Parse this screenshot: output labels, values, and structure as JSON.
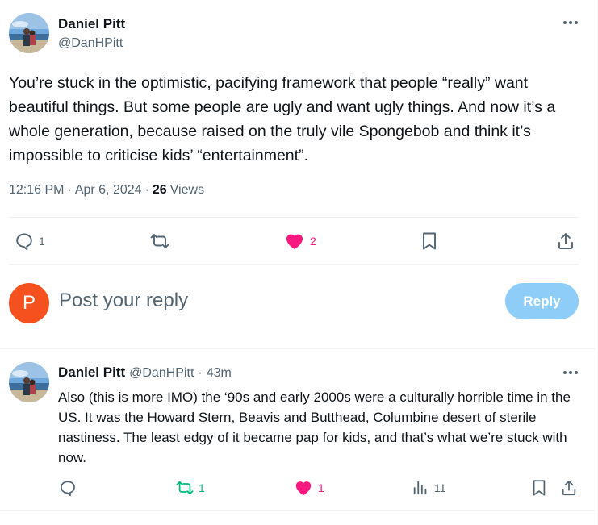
{
  "main_tweet": {
    "author_name": "Daniel Pitt",
    "author_handle": "@DanHPitt",
    "text": "You’re stuck in the optimistic, pacifying framework that people “really” want beautiful things. But some people are ugly and want ugly things. And now it’s a whole generation, because raised on the truly vile Spongebob and think it’s impossible to criticise kids’ “entertainment”.",
    "time": "12:16 PM",
    "date": "Apr 6, 2024",
    "views_count": "26",
    "views_label": "Views",
    "replies": "1",
    "likes": "2",
    "icons": [
      "reply-icon",
      "retweet-icon",
      "like-icon",
      "bookmark-icon",
      "share-icon"
    ]
  },
  "composer": {
    "avatar_letter": "P",
    "placeholder": "Post your reply",
    "reply_label": "Reply"
  },
  "reply_tweet": {
    "author_name": "Daniel Pitt",
    "author_handle": "@DanHPitt",
    "separator": "·",
    "age": "43m",
    "text": "Also (this is more IMO) the ‘90s and early 2000s were a culturally horrible time in the US. It was the Howard Stern, Beavis and Butthead, Columbine desert of sterile nastiness. The least edgy of it became pap for kids, and that’s what we’re stuck with now.",
    "retweets": "1",
    "likes": "1",
    "views": "11"
  },
  "colors": {
    "like_pink": "#f91880",
    "retweet_green": "#00ba7c",
    "muted_gray": "#536471",
    "reply_button": "#8ecdf8",
    "avatar_orange": "#f4511e"
  }
}
